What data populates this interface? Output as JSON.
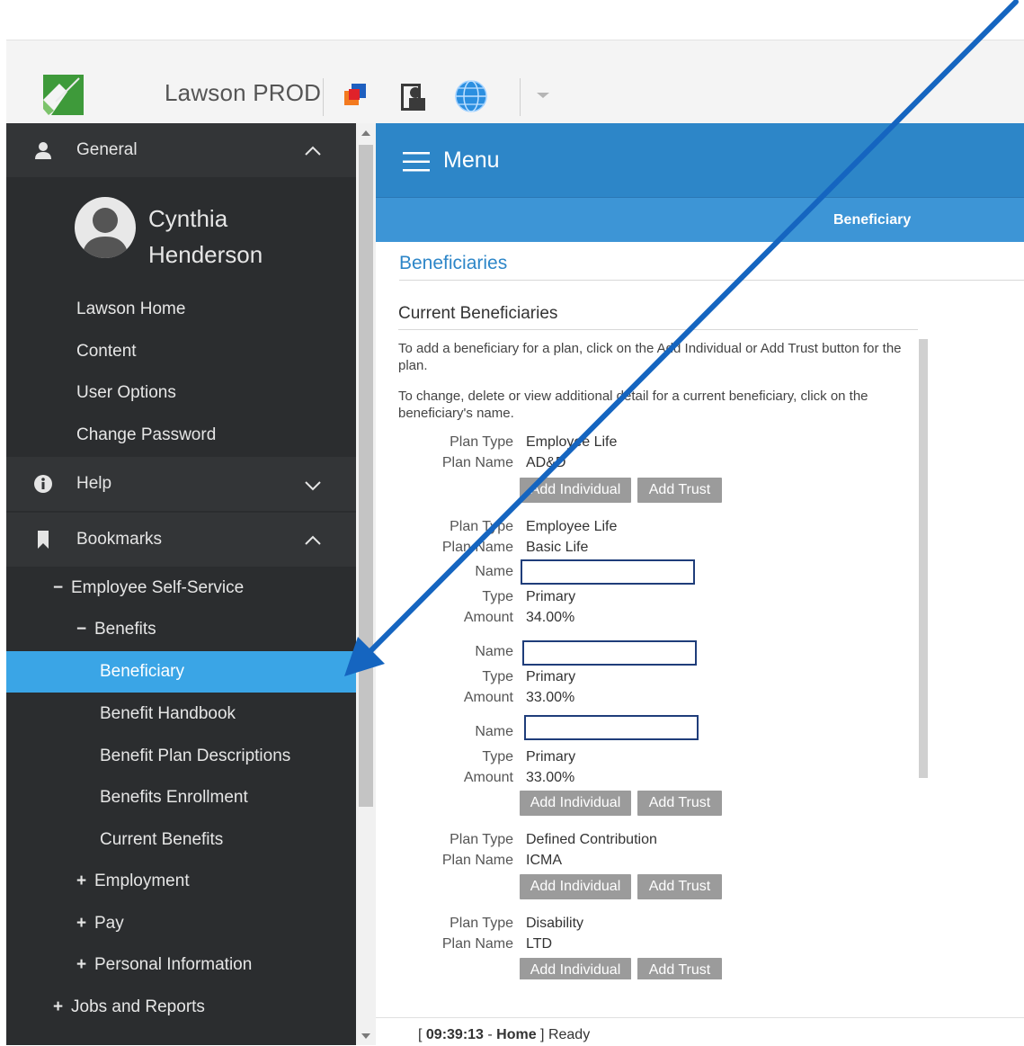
{
  "app": {
    "title": "Lawson PROD"
  },
  "sidebar": {
    "general_label": "General",
    "user_first": "Cynthia",
    "user_last": "Henderson",
    "general_items": [
      "Lawson Home",
      "Content",
      "User Options",
      "Change Password"
    ],
    "help_label": "Help",
    "bookmarks_label": "Bookmarks",
    "tree": {
      "ess": "Employee Self-Service",
      "benefits": "Benefits",
      "beneficiary": "Beneficiary",
      "benefit_handbook": "Benefit Handbook",
      "benefit_plan_descriptions": "Benefit Plan Descriptions",
      "benefits_enrollment": "Benefits Enrollment",
      "current_benefits": "Current Benefits",
      "employment": "Employment",
      "pay": "Pay",
      "personal_information": "Personal Information",
      "jobs_and_reports": "Jobs and Reports"
    },
    "signs": {
      "minus": "−",
      "plus": "+"
    }
  },
  "menubar": {
    "label": "Menu"
  },
  "crumb": {
    "title": "Beneficiary"
  },
  "page": {
    "title": "Beneficiaries",
    "subtitle": "Current Beneficiaries",
    "instruction_add": "To add a beneficiary for a plan, click on the Add Individual or Add Trust button for the plan.",
    "instruction_change": "To change, delete or view additional detail for a current beneficiary, click on the beneficiary's name.",
    "labels": {
      "plan_type": "Plan Type",
      "plan_name": "Plan Name",
      "name": "Name",
      "type": "Type",
      "amount": "Amount"
    },
    "buttons": {
      "add_individual": "Add Individual",
      "add_trust": "Add Trust"
    },
    "plans": [
      {
        "plan_type": "Employee Life",
        "plan_name": "AD&D"
      },
      {
        "plan_type": "Employee Life",
        "plan_name": "Basic Life",
        "beneficiaries": [
          {
            "name": "",
            "type": "Primary",
            "amount": "34.00%"
          },
          {
            "name": "",
            "type": "Primary",
            "amount": "33.00%"
          },
          {
            "name": "",
            "type": "Primary",
            "amount": "33.00%"
          }
        ]
      },
      {
        "plan_type": "Defined Contribution",
        "plan_name": "ICMA"
      },
      {
        "plan_type": "Disability",
        "plan_name": "LTD"
      }
    ]
  },
  "status": {
    "time": "09:39:13",
    "context": "Home",
    "state": "Ready"
  },
  "colors": {
    "accent": "#2d86c8",
    "active_item": "#3aa5e6",
    "arrow": "#1565c0",
    "sidebar_bg": "#2b2d2f"
  }
}
